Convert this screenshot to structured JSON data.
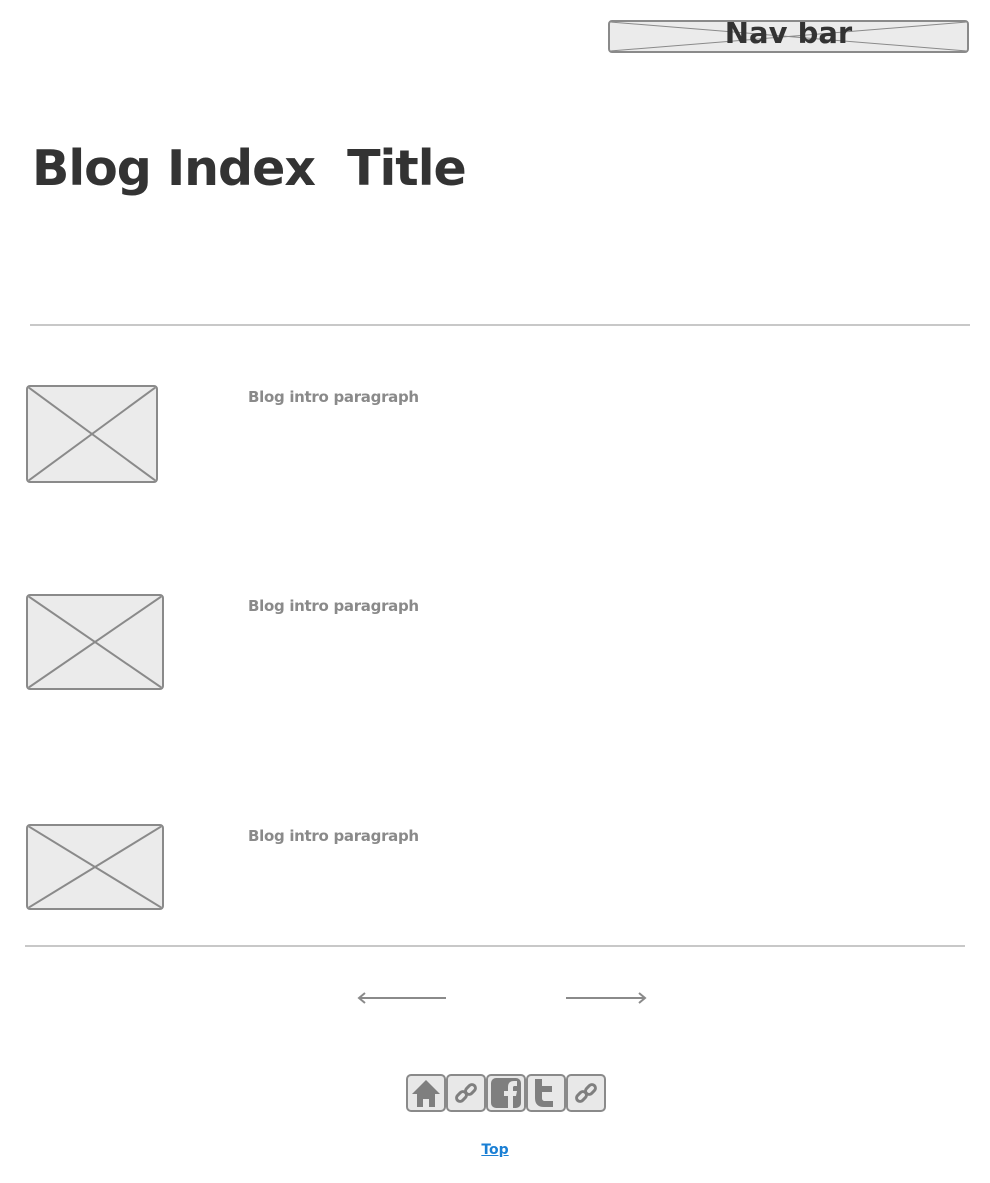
{
  "nav": {
    "label": "Nav bar"
  },
  "page_title": "Blog Index  Title",
  "posts": [
    {
      "intro": "Blog intro paragraph"
    },
    {
      "intro": "Blog intro paragraph"
    },
    {
      "intro": "Blog intro paragraph"
    }
  ],
  "pagination": {
    "prev_icon": "arrow-left-icon",
    "next_icon": "arrow-right-icon"
  },
  "social": [
    "home-icon",
    "link-icon",
    "facebook-icon",
    "twitter-icon",
    "link-icon"
  ],
  "footer": {
    "top_link": "Top"
  },
  "colors": {
    "link": "#1a7fd4",
    "text": "#333333",
    "muted": "#8a8a8a"
  }
}
